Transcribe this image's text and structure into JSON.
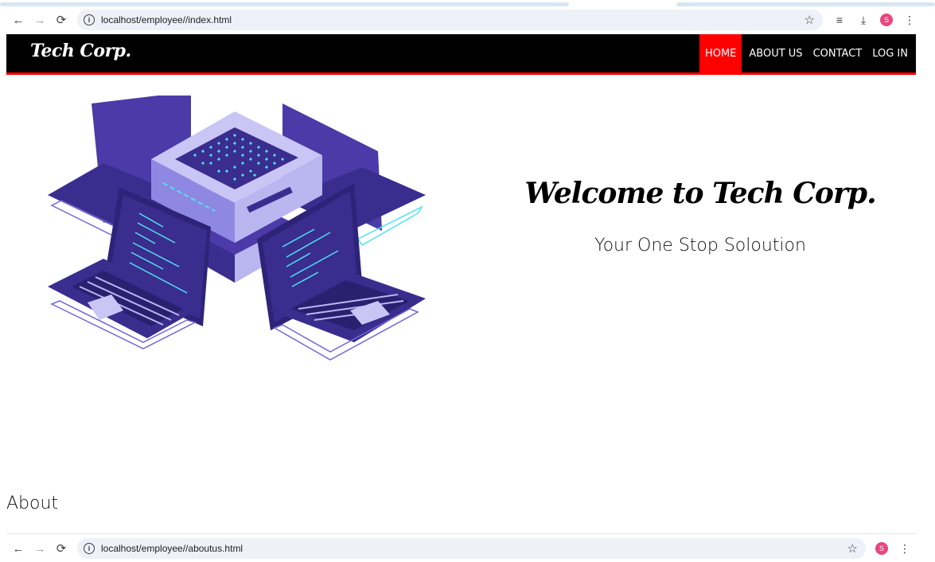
{
  "browser_top": {
    "url": "localhost/employee//index.html",
    "avatar_letter": "S"
  },
  "browser_bottom": {
    "url": "localhost/employee//aboutus.html",
    "avatar_letter": "S"
  },
  "site": {
    "logo": "Tech Corp.",
    "nav": [
      {
        "label": "HOME",
        "active": true
      },
      {
        "label": "ABOUT US",
        "active": false
      },
      {
        "label": "CONTACT",
        "active": false
      },
      {
        "label": "LOG IN",
        "active": false
      }
    ],
    "hero_title": "Welcome to Tech Corp.",
    "hero_subtitle": "Your One Stop Soloution",
    "about_heading": "About"
  },
  "colors": {
    "nav_bg": "#000000",
    "accent": "#ff0000",
    "illustration_primary": "#4b3aa8",
    "illustration_light": "#b9b6f0",
    "illustration_glow": "#4fe3f0"
  }
}
